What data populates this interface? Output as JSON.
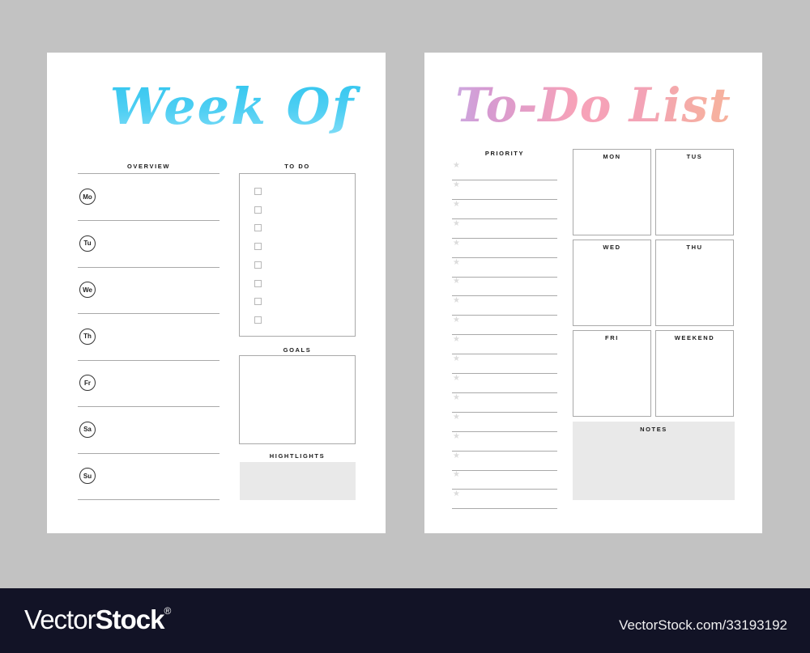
{
  "left_page": {
    "title": "Week Of",
    "overview_label": "OVERVIEW",
    "days": [
      "Mo",
      "Tu",
      "We",
      "Th",
      "Fr",
      "Sa",
      "Su"
    ],
    "todo_label": "TO DO",
    "todo_item_count": 8,
    "goals_label": "GOALS",
    "highlights_label": "HIGHTLIGHTS",
    "title_gradient": [
      "#2bc3ee",
      "#8fe0f8"
    ]
  },
  "right_page": {
    "title": "To-Do List",
    "priority_label": "PRIORITY",
    "priority_row_count": 18,
    "priority_icon": "star-icon",
    "day_boxes": [
      "MON",
      "TUS",
      "WED",
      "THU",
      "FRI",
      "WEEKEND"
    ],
    "notes_label": "NOTES",
    "title_gradient": [
      "#c5b9ee",
      "#f7a2b8",
      "#f7b49a"
    ]
  },
  "footer": {
    "brand_thin": "Vector",
    "brand_bold": "Stock",
    "brand_mark": "®",
    "image_id": "VectorStock.com/33193192",
    "background": "#121326"
  }
}
